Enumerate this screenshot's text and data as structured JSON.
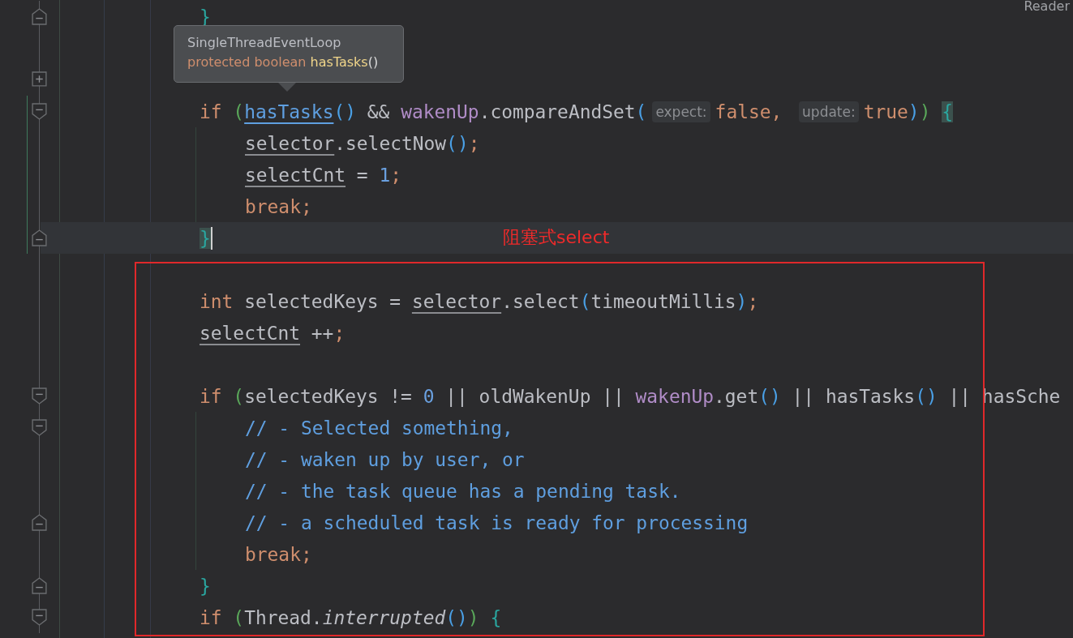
{
  "reader_mode": "Reader",
  "lines": [
    {
      "kind": "code",
      "indented": false,
      "fold": {
        "kind": "end"
      },
      "tokens": [
        {
          "kind": "brace",
          "text": "}"
        }
      ]
    },
    {
      "kind": "blank",
      "indented": false
    },
    {
      "kind": "blank",
      "indented": false,
      "fold": {
        "kind": "collapsed"
      }
    },
    {
      "kind": "code",
      "indented": false,
      "fold": {
        "kind": "start"
      },
      "tokens": [
        {
          "kind": "kw",
          "text": "if "
        },
        {
          "kind": "paren1",
          "text": "("
        },
        {
          "kind": "link",
          "text": "hasTasks"
        },
        {
          "kind": "paren2",
          "text": "()"
        },
        {
          "kind": "plain",
          "text": " && "
        },
        {
          "kind": "member",
          "text": "wakenUp"
        },
        {
          "kind": "plain",
          "text": ".compareAndSet"
        },
        {
          "kind": "paren2",
          "text": "("
        },
        {
          "kind": "hint",
          "text": "expect:"
        },
        {
          "kind": "kw",
          "text": "false, "
        },
        {
          "kind": "hint",
          "text": "update:"
        },
        {
          "kind": "kw",
          "text": "true"
        },
        {
          "kind": "paren2",
          "text": ")"
        },
        {
          "kind": "paren1",
          "text": ") "
        },
        {
          "kind": "brace-match",
          "text": "{"
        }
      ]
    },
    {
      "kind": "code",
      "indented": true,
      "tokens": [
        {
          "kind": "field",
          "text": "selector"
        },
        {
          "kind": "plain",
          "text": ".selectNow"
        },
        {
          "kind": "paren2",
          "text": "()"
        },
        {
          "kind": "kw",
          "text": ";"
        }
      ]
    },
    {
      "kind": "code",
      "indented": true,
      "tokens": [
        {
          "kind": "field",
          "text": "selectCnt"
        },
        {
          "kind": "plain",
          "text": " = "
        },
        {
          "kind": "num",
          "text": "1"
        },
        {
          "kind": "kw",
          "text": ";"
        }
      ]
    },
    {
      "kind": "code",
      "indented": true,
      "tokens": [
        {
          "kind": "kw",
          "text": "break;"
        }
      ]
    },
    {
      "kind": "code",
      "indented": false,
      "fold": {
        "kind": "end"
      },
      "current": true,
      "tokens": [
        {
          "kind": "brace-match",
          "text": "}"
        }
      ]
    },
    {
      "kind": "blank",
      "indented": false
    },
    {
      "kind": "code",
      "indented": false,
      "tokens": [
        {
          "kind": "kw",
          "text": "int "
        },
        {
          "kind": "plain",
          "text": "selectedKeys = "
        },
        {
          "kind": "field",
          "text": "selector"
        },
        {
          "kind": "plain",
          "text": ".select"
        },
        {
          "kind": "paren2",
          "text": "("
        },
        {
          "kind": "plain",
          "text": "timeoutMillis"
        },
        {
          "kind": "paren2",
          "text": ")"
        },
        {
          "kind": "kw",
          "text": ";"
        }
      ]
    },
    {
      "kind": "code",
      "indented": false,
      "tokens": [
        {
          "kind": "field",
          "text": "selectCnt"
        },
        {
          "kind": "plain",
          "text": " ++"
        },
        {
          "kind": "kw",
          "text": ";"
        }
      ]
    },
    {
      "kind": "blank",
      "indented": false
    },
    {
      "kind": "code",
      "indented": false,
      "fold": {
        "kind": "start"
      },
      "tokens": [
        {
          "kind": "kw",
          "text": "if "
        },
        {
          "kind": "paren1",
          "text": "("
        },
        {
          "kind": "plain",
          "text": "selectedKeys != "
        },
        {
          "kind": "num",
          "text": "0"
        },
        {
          "kind": "plain",
          "text": " || oldWakenUp || "
        },
        {
          "kind": "member",
          "text": "wakenUp"
        },
        {
          "kind": "plain",
          "text": ".get"
        },
        {
          "kind": "paren2",
          "text": "()"
        },
        {
          "kind": "plain",
          "text": " || hasTasks"
        },
        {
          "kind": "paren2",
          "text": "()"
        },
        {
          "kind": "plain",
          "text": " || hasSche"
        }
      ]
    },
    {
      "kind": "code",
      "indented": true,
      "fold": {
        "kind": "start"
      },
      "tokens": [
        {
          "kind": "comment",
          "text": "// - Selected something,"
        }
      ]
    },
    {
      "kind": "code",
      "indented": true,
      "tokens": [
        {
          "kind": "comment",
          "text": "// - waken up by user, or"
        }
      ]
    },
    {
      "kind": "code",
      "indented": true,
      "tokens": [
        {
          "kind": "comment",
          "text": "// - the task queue has a pending task."
        }
      ]
    },
    {
      "kind": "code",
      "indented": true,
      "fold": {
        "kind": "end"
      },
      "tokens": [
        {
          "kind": "comment",
          "text": "// - a scheduled task is ready for processing"
        }
      ]
    },
    {
      "kind": "code",
      "indented": true,
      "tokens": [
        {
          "kind": "kw",
          "text": "break;"
        }
      ]
    },
    {
      "kind": "code",
      "indented": false,
      "fold": {
        "kind": "end"
      },
      "tokens": [
        {
          "kind": "brace",
          "text": "}"
        }
      ]
    },
    {
      "kind": "code",
      "indented": false,
      "fold": {
        "kind": "start"
      },
      "tokens": [
        {
          "kind": "kw",
          "text": "if "
        },
        {
          "kind": "paren1",
          "text": "("
        },
        {
          "kind": "plain",
          "text": "Thread."
        },
        {
          "kind": "italic",
          "text": "interrupted"
        },
        {
          "kind": "paren2",
          "text": "()"
        },
        {
          "kind": "paren1",
          "text": ") "
        },
        {
          "kind": "brace",
          "text": "{"
        }
      ]
    }
  ],
  "tooltip": {
    "title": "SingleThreadEventLoop",
    "signature": [
      {
        "kind": "modifier",
        "text": "protected boolean "
      },
      {
        "kind": "name",
        "text": "hasTasks"
      },
      {
        "kind": "plain",
        "text": "()"
      }
    ]
  },
  "annotation": {
    "label": "阻塞式select"
  }
}
